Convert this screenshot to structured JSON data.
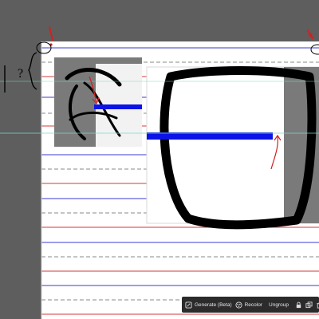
{
  "annotations": {
    "left_question": "?"
  },
  "taskbar": {
    "generate_label": "Generate (Beta)",
    "recolor_label": "Recolor",
    "ungroup_label": "Ungroup"
  },
  "colors": {
    "workspace": "#5e5e5e",
    "paper": "#ffffff",
    "rule_blue": "#3a3ad6",
    "rule_red": "#d63a3a",
    "rule_gray": "#888888",
    "crosshair_green": "#7fd7c8",
    "marker_blue": "#0a14e6",
    "annotation_red": "#d32020",
    "taskbar_bg": "#2b2b2b"
  },
  "icons": {
    "generate": "sparkle-icon",
    "recolor": "recolor-icon",
    "lock": "lock-icon",
    "duplicate": "duplicate-icon",
    "delete": "trash-icon"
  }
}
